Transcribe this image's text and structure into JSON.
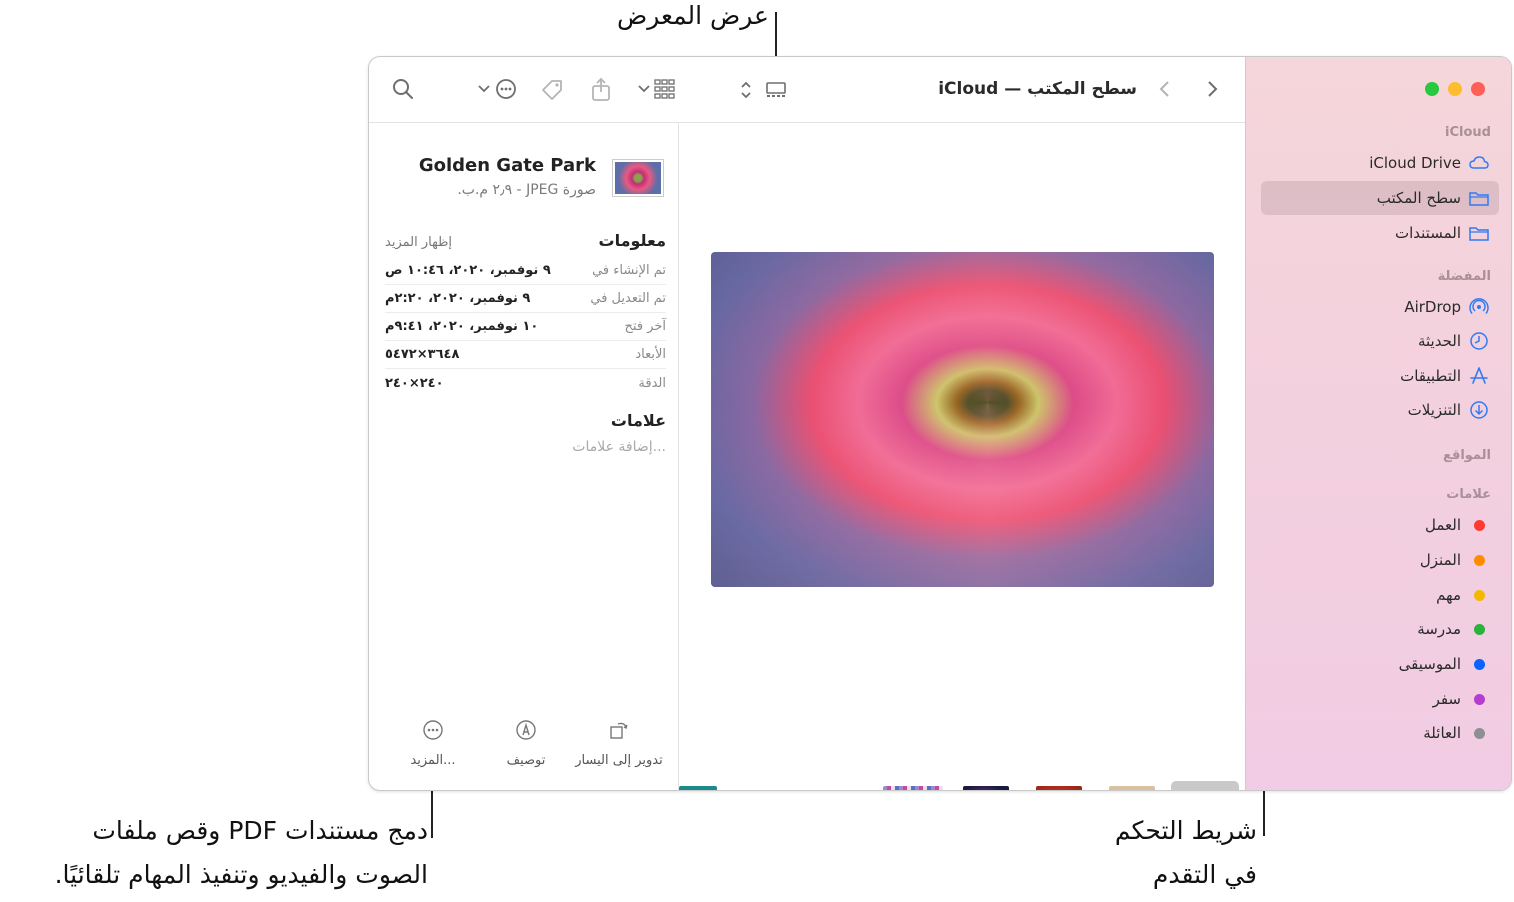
{
  "callouts": {
    "gallery_view": "عرض المعرض",
    "scrubber_line1": "شريط التحكم",
    "scrubber_line2": "في التقدم",
    "quick_actions_line1": "دمج مستندات PDF وقص ملفات",
    "quick_actions_line2": "الصوت والفيديو وتنفيذ المهام تلقائيًا."
  },
  "window": {
    "title": "سطح المكتب — iCloud"
  },
  "sidebar": {
    "sections": [
      {
        "label": "iCloud",
        "items": [
          {
            "label": "iCloud Drive",
            "icon": "cloud-icon",
            "selected": false
          },
          {
            "label": "سطح المكتب",
            "icon": "folder-icon",
            "selected": true
          },
          {
            "label": "المستندات",
            "icon": "folder-icon",
            "selected": false
          }
        ]
      },
      {
        "label": "المفضلة",
        "items": [
          {
            "label": "AirDrop",
            "icon": "airdrop-icon"
          },
          {
            "label": "الحديثة",
            "icon": "clock-icon"
          },
          {
            "label": "التطبيقات",
            "icon": "apps-icon"
          },
          {
            "label": "التنزيلات",
            "icon": "download-icon"
          }
        ]
      },
      {
        "label": "المواقع",
        "items": []
      },
      {
        "label": "علامات",
        "items": [
          {
            "label": "العمل",
            "color": "#ff3b30"
          },
          {
            "label": "المنزل",
            "color": "#ff8c00"
          },
          {
            "label": "مهم",
            "color": "#f5b800"
          },
          {
            "label": "مدرسة",
            "color": "#28b33a"
          },
          {
            "label": "الموسيقى",
            "color": "#0a62ff"
          },
          {
            "label": "سفر",
            "color": "#b43cd0"
          },
          {
            "label": "العائلة",
            "color": "#8e8e93"
          }
        ]
      }
    ]
  },
  "inspector": {
    "file_name": "Golden Gate Park",
    "file_kind": "صورة JPEG - ٢٫٩ م.ب.",
    "info_title": "معلومات",
    "show_more": "إظهار المزيد",
    "rows": [
      {
        "label": "تم الإنشاء في",
        "value": "٩ نوفمبر، ٢٠٢٠، ١٠:٤٦ ص"
      },
      {
        "label": "تم التعديل في",
        "value": "٩ نوفمبر، ٢٠٢٠، ٢:٢٠م"
      },
      {
        "label": "آخر فتح",
        "value": "١٠ نوفمبر، ٢٠٢٠، ٩:٤١م"
      },
      {
        "label": "الأبعاد",
        "value": "٣٦٤٨×٥٤٧٢"
      },
      {
        "label": "الدقة",
        "value": "٢٤٠×٢٤٠"
      }
    ],
    "tags_title": "علامات",
    "add_tags": "إضافة علامات...",
    "actions": {
      "rotate_left": "تدوير إلى اليسار",
      "markup": "توصيف",
      "more": "المزيد..."
    }
  },
  "colors": {
    "close": "#fe5f57",
    "minimize": "#febc2e",
    "zoom": "#28c840",
    "accent": "#2f7bf5"
  }
}
